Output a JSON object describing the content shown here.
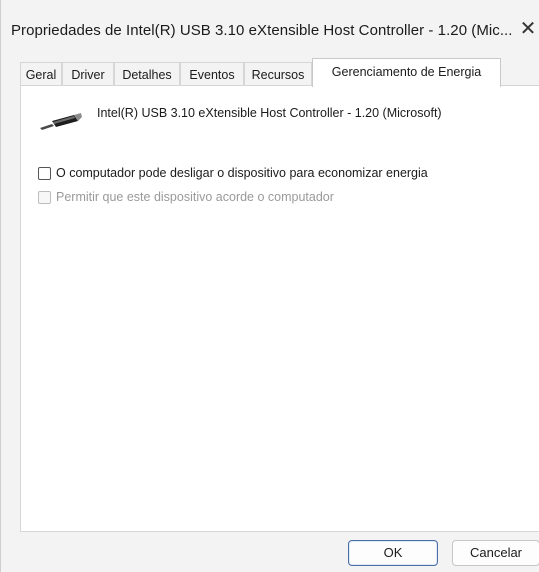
{
  "window": {
    "title": "Propriedades de Intel(R) USB 3.10 eXtensible Host Controller - 1.20 (Mic...",
    "close_glyph": "✕"
  },
  "tabs": [
    {
      "label": "Geral",
      "active": false
    },
    {
      "label": "Driver",
      "active": false
    },
    {
      "label": "Detalhes",
      "active": false
    },
    {
      "label": "Eventos",
      "active": false
    },
    {
      "label": "Recursos",
      "active": false
    },
    {
      "label": "Gerenciamento de Energia",
      "active": true
    }
  ],
  "device": {
    "icon": "usb-connector-icon",
    "name": "Intel(R) USB 3.10 eXtensible Host Controller - 1.20 (Microsoft)"
  },
  "options": {
    "allow_power_off": {
      "label": "O computador pode desligar o dispositivo para economizar energia",
      "checked": false,
      "enabled": true
    },
    "allow_wake": {
      "label": "Permitir que este dispositivo acorde o computador",
      "checked": false,
      "enabled": false
    }
  },
  "buttons": {
    "ok": "OK",
    "cancel": "Cancelar"
  }
}
